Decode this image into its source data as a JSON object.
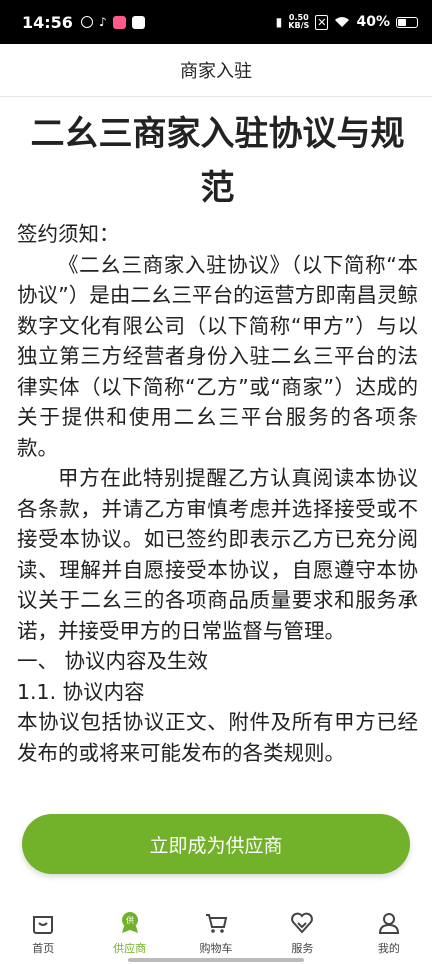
{
  "status_bar": {
    "time": "14:56",
    "net_speed_value": "0.50",
    "net_speed_unit": "KB/S",
    "battery": "40%"
  },
  "nav": {
    "title": "商家入驻"
  },
  "document": {
    "title": "二幺三商家入驻协议与规范",
    "paragraphs": [
      {
        "text": "签约须知：",
        "indent": false
      },
      {
        "text": "《二幺三商家入驻协议》（以下简称“本协议”）是由二幺三平台的运营方即南昌灵鲸数字文化有限公司（以下简称“甲方”）与以独立第三方经营者身份入驻二幺三平台的法律实体（以下简称“乙方”或“商家”）达成的关于提供和使用二幺三平台服务的各项条款。",
        "indent": true
      },
      {
        "text": "甲方在此特别提醒乙方认真阅读本协议各条款，并请乙方审慎考虑并选择接受或不接受本协议。如已签约即表示乙方已充分阅读、理解并自愿接受本协议，自愿遵守本协议关于二幺三的各项商品质量要求和服务承诺，并接受甲方的日常监督与管理。",
        "indent": true
      },
      {
        "text": "一、 协议内容及生效",
        "indent": false
      },
      {
        "text": "1.1. 协议内容",
        "indent": false
      },
      {
        "text": "本协议包括协议正文、附件及所有甲方已经发布的或将来可能发布的各类规则。",
        "indent": false
      }
    ]
  },
  "cta": {
    "label": "立即成为供应商"
  },
  "tabs": [
    {
      "label": "首页",
      "icon": "home-bag-icon",
      "active": false
    },
    {
      "label": "供应商",
      "icon": "supplier-badge-icon",
      "active": true
    },
    {
      "label": "购物车",
      "icon": "cart-icon",
      "active": false
    },
    {
      "label": "服务",
      "icon": "service-heart-icon",
      "active": false
    },
    {
      "label": "我的",
      "icon": "profile-icon",
      "active": false
    }
  ],
  "colors": {
    "accent": "#72b22a",
    "text": "#222222",
    "status_bar": "#000000"
  }
}
